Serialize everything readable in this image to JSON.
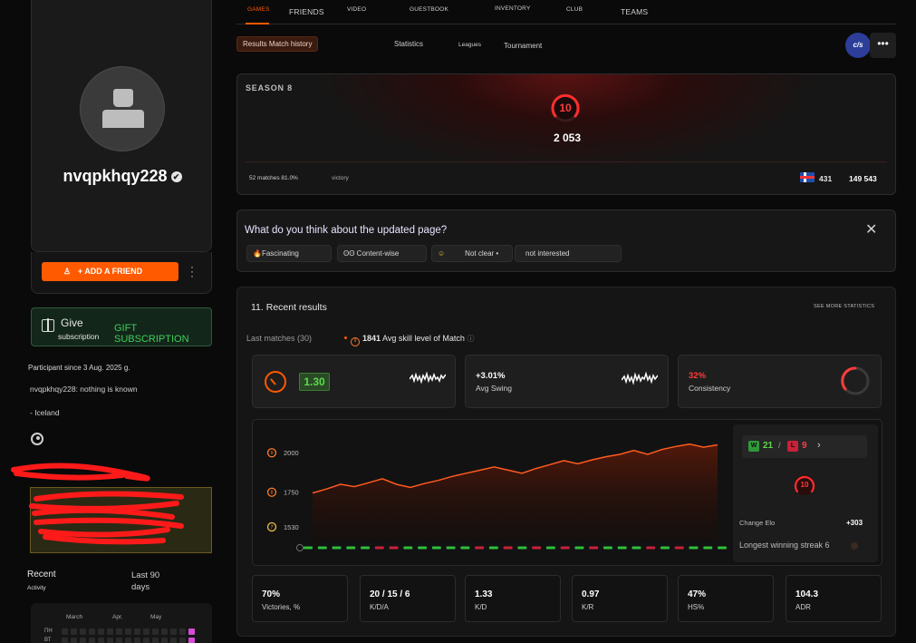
{
  "profile": {
    "username": "nvqpkhqy228",
    "add_friend_label": "+ ADD A FRIEND",
    "give_label": "Give",
    "subscription_label": "subscription",
    "gift_link_label": "GIFT SUBSCRIPTION",
    "participant_since": "Participant since 3 Aug. 2025 g.",
    "about": "nvqpkhqy228: nothing is known",
    "country": "- Iceland"
  },
  "activity": {
    "title": "Recent",
    "subtitle": "Activity",
    "range": "Last 90 days",
    "months": [
      "March",
      "Apr.",
      "May"
    ],
    "days": [
      "ПН",
      "ВТ"
    ]
  },
  "nav": {
    "tabs": [
      "GAMES",
      "FRIENDS",
      "VIDEO",
      "GUESTBOOK",
      "INVENTORY",
      "CLUB",
      "TEAMS"
    ],
    "active_tab": "GAMES",
    "subtabs": [
      "Results Match history",
      "Statistics",
      "Leagues",
      "Tournament"
    ],
    "game_icon": "cs-logo-icon",
    "game_label": "c/s",
    "more_label": "•••"
  },
  "season": {
    "label": "SEASON 8",
    "level": "10",
    "elo": "2 053",
    "matches": "52 matches 81.0%",
    "victory": "victory",
    "country_rank": "431",
    "world_rank": "149 543"
  },
  "feedback": {
    "question": "What do you think about the updated page?",
    "options": [
      "Fascinating",
      "Content-wise",
      "Not clear •",
      "not interested"
    ],
    "option_icons": [
      "fire-icon",
      "eyes-icon",
      "thinking-face-icon",
      ""
    ]
  },
  "results": {
    "title": "11. Recent results",
    "see_more": "SEE MORE STATISTICS",
    "last_matches": "Last matches (30)",
    "avg_skill_value": "1841",
    "avg_skill_label": "Avg skill level of Match",
    "kd_ratio": "1.30",
    "avg_swing": "+3.01%",
    "avg_swing_label": "Avg Swing",
    "consistency": "32%",
    "consistency_label": "Consistency",
    "wins": "21",
    "losses": "9",
    "win_badge": "W",
    "loss_badge": "L",
    "level_badge": "10",
    "change_elo_label": "Change Elo",
    "change_elo_value": "+303",
    "streak_label": "Longest winning streak 6",
    "mini_stats": [
      {
        "value": "70%",
        "label": "Victories, %"
      },
      {
        "value": "20 / 15 / 6",
        "label": "K/D/A"
      },
      {
        "value": "1.33",
        "label": "K/D"
      },
      {
        "value": "0.97",
        "label": "K/R"
      },
      {
        "value": "47%",
        "label": "HS%"
      },
      {
        "value": "104.3",
        "label": "ADR"
      }
    ]
  },
  "chart_data": {
    "type": "area",
    "y_ticks": [
      "2000",
      "1750",
      "1530"
    ],
    "ylim": [
      1530,
      2053
    ],
    "values": [
      1745,
      1770,
      1800,
      1785,
      1810,
      1835,
      1800,
      1780,
      1805,
      1825,
      1850,
      1870,
      1890,
      1910,
      1890,
      1870,
      1900,
      1925,
      1950,
      1930,
      1955,
      1975,
      1990,
      2015,
      1990,
      2020,
      2040,
      2055,
      2035,
      2050
    ],
    "results": [
      "W",
      "W",
      "W",
      "W",
      "W",
      "L",
      "L",
      "W",
      "W",
      "W",
      "W",
      "W",
      "L",
      "W",
      "L",
      "W",
      "L",
      "W",
      "L",
      "W",
      "L",
      "W",
      "W",
      "W",
      "L",
      "W",
      "L",
      "W",
      "W",
      "W"
    ],
    "win_color": "#2fbf3a",
    "loss_color": "#c8213a",
    "line_color": "#ff5a1e"
  }
}
